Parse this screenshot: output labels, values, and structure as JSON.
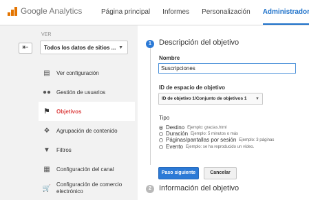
{
  "header": {
    "logo": {
      "google": "Google",
      "product": "Analytics"
    },
    "nav": [
      {
        "label": "Página principal",
        "active": false
      },
      {
        "label": "Informes",
        "active": false
      },
      {
        "label": "Personalización",
        "active": false
      },
      {
        "label": "Administrador",
        "active": true
      }
    ]
  },
  "sidebar": {
    "back_icon": "arrow-left-icon",
    "view_label": "VER",
    "view_value": "Todos los datos de sitios ...",
    "items": [
      {
        "label": "Ver configuración",
        "icon": "document-icon",
        "active": false
      },
      {
        "label": "Gestión de usuarios",
        "icon": "users-icon",
        "active": false
      },
      {
        "label": "Objetivos",
        "icon": "flag-icon",
        "active": true
      },
      {
        "label": "Agrupación de contenido",
        "icon": "grouping-icon",
        "active": false
      },
      {
        "label": "Filtros",
        "icon": "filter-icon",
        "active": false
      },
      {
        "label": "Configuración del canal",
        "icon": "channel-icon",
        "active": false
      },
      {
        "label": "Configuración de comercio electrónico",
        "icon": "cart-icon",
        "active": false
      }
    ]
  },
  "main": {
    "step1": {
      "number": "1",
      "title": "Descripción del objetivo",
      "name_label": "Nombre",
      "name_value": "Suscripciones",
      "id_label": "ID de espacio de objetivo",
      "id_value": "ID de objetivo 1/Conjunto de objetivos 1",
      "type_label": "Tipo",
      "types": [
        {
          "label": "Destino",
          "example": "Ejemplo: gracias.html",
          "checked": true
        },
        {
          "label": "Duración",
          "example": "Ejemplo: 5 minutos o más",
          "checked": false
        },
        {
          "label": "Páginas/pantallas por sesión",
          "example": "Ejemplo: 3 páginas",
          "checked": false
        },
        {
          "label": "Evento",
          "example": "Ejemplo: se ha reproducido un vídeo.",
          "checked": false
        }
      ],
      "next_button": "Paso siguiente",
      "cancel_button": "Cancelar"
    },
    "step2": {
      "number": "2",
      "title": "Información del objetivo"
    }
  },
  "colors": {
    "accent": "#2c7ad6",
    "active_menu": "#dd4444",
    "logo": "#e37400"
  }
}
